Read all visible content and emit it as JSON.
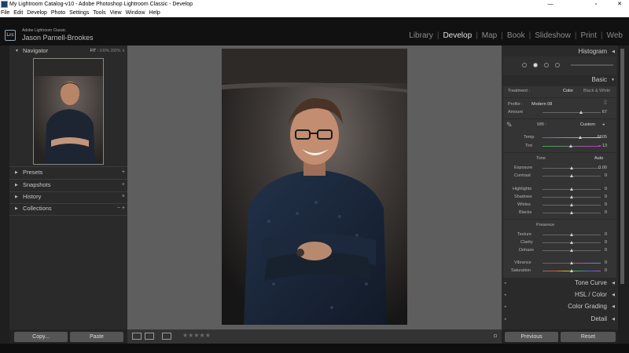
{
  "window": {
    "title": "My Lightroom Catalog-v10 - Adobe Photoshop Lightroom Classic - Develop",
    "minimize_glyph": "—",
    "maximize_glyph": "▫",
    "close_glyph": "✕"
  },
  "menu": [
    "File",
    "Edit",
    "Develop",
    "Photo",
    "Settings",
    "Tools",
    "View",
    "Window",
    "Help"
  ],
  "identity": {
    "logo": "Lrc",
    "product": "Adobe Lightroom Classic",
    "user": "Jason Parnell-Brookes"
  },
  "modules": [
    {
      "label": "Library",
      "active": false
    },
    {
      "label": "Develop",
      "active": true
    },
    {
      "label": "Map",
      "active": false
    },
    {
      "label": "Book",
      "active": false
    },
    {
      "label": "Slideshow",
      "active": false
    },
    {
      "label": "Print",
      "active": false
    },
    {
      "label": "Web",
      "active": false
    }
  ],
  "left_panel": {
    "navigator": {
      "label": "Navigator",
      "opts": [
        "FIT",
        "100%",
        "200%"
      ],
      "more": "⇕"
    },
    "sections": [
      {
        "label": "Presets",
        "action": "+"
      },
      {
        "label": "Snapshots",
        "action": "+"
      },
      {
        "label": "History",
        "action": "×"
      },
      {
        "label": "Collections",
        "action": "− +"
      }
    ],
    "copy_button": "Copy...",
    "paste_button": "Paste"
  },
  "toolbar": {
    "rating_stars": "★★★★★"
  },
  "right_panel": {
    "histogram": "Histogram",
    "basic": "Basic",
    "treatment": {
      "label": "Treatment :",
      "options": [
        "Color",
        "Black & White"
      ],
      "selected": "Color"
    },
    "profile": {
      "label": "Profile :",
      "value": "Modern 08"
    },
    "amount": {
      "label": "Amount",
      "value": "67",
      "level": 0.67
    },
    "wb": {
      "label": "WB :",
      "value": "Custom"
    },
    "temp": {
      "label": "Temp",
      "value": "6605",
      "level": 0.62
    },
    "tint": {
      "label": "Tint",
      "value": "− 13",
      "level": 0.47
    },
    "tone": {
      "label": "Tone",
      "auto": "Auto"
    },
    "tone_sliders": [
      {
        "label": "Exposure",
        "value": "0.00"
      },
      {
        "label": "Contrast",
        "value": "0"
      }
    ],
    "tone_sliders2": [
      {
        "label": "Highlights",
        "value": "0"
      },
      {
        "label": "Shadows",
        "value": "0"
      },
      {
        "label": "Whites",
        "value": "0"
      },
      {
        "label": "Blacks",
        "value": "0"
      }
    ],
    "presence": {
      "label": "Presence"
    },
    "presence_sliders": [
      {
        "label": "Texture",
        "value": "0"
      },
      {
        "label": "Clarity",
        "value": "0"
      },
      {
        "label": "Dehaze",
        "value": "0"
      }
    ],
    "color_sliders": [
      {
        "label": "Vibrance",
        "value": "0"
      },
      {
        "label": "Saturation",
        "value": "0"
      }
    ],
    "collapsed": [
      {
        "label": "Tone Curve"
      },
      {
        "label": "HSL / Color"
      },
      {
        "label": "Color Grading"
      },
      {
        "label": "Detail"
      }
    ],
    "previous_button": "Previous",
    "reset_button": "Reset"
  },
  "colors": {
    "active_module": "#e0e0e0",
    "panel_bg": "#2a2a2a",
    "workspace_bg": "#5e5e5e"
  }
}
